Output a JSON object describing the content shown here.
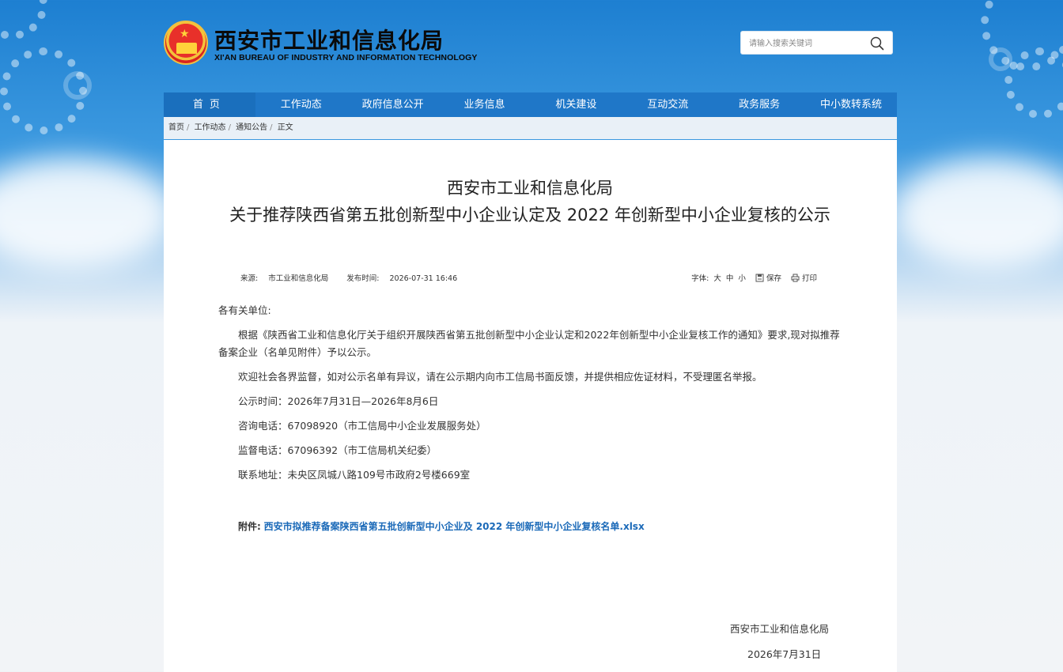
{
  "header": {
    "title": "西安市工业和信息化局",
    "subtitle": "XI'AN BUREAU OF INDUSTRY AND INFORMATION TECHNOLOGY",
    "search_placeholder": "请输入搜索关键词"
  },
  "nav": {
    "items": [
      "首页",
      "工作动态",
      "政府信息公开",
      "业务信息",
      "机关建设",
      "互动交流",
      "政务服务",
      "中小数转系统"
    ]
  },
  "breadcrumb": [
    "首页",
    "工作动态",
    "通知公告",
    "正文"
  ],
  "article": {
    "title_line1": "西安市工业和信息化局",
    "title_line2": "关于推荐陕西省第五批创新型中小企业认定及 2022 年创新型中小企业复核的公示",
    "source_label": "来源:",
    "source": "市工业和信息化局",
    "time_label": "发布时间:",
    "time": "2026-07-31 16:46",
    "font_label": "字体:",
    "font_large": "大",
    "font_medium": "中",
    "font_small": "小",
    "save": "保存",
    "print": "打印",
    "greeting": "各有关单位:",
    "para1": "根据《陕西省工业和信息化厅关于组织开展陕西省第五批创新型中小企业认定和2022年创新型中小企业复核工作的通知》要求,现对拟推荐备案企业（名单见附件）予以公示。",
    "para2": "欢迎社会各界监督，如对公示名单有异议，请在公示期内向市工信局书面反馈，并提供相应佐证材料，不受理匿名举报。",
    "para3": "公示时间：2026年7月31日—2026年8月6日",
    "para4": "咨询电话：67098920（市工信局中小企业发展服务处）",
    "para5": "监督电话：67096392（市工信局机关纪委）",
    "para6": "联系地址：未央区凤城八路109号市政府2号楼669室",
    "attachment_label": "附件:",
    "attachment_link": "西安市拟推荐备案陕西省第五批创新型中小企业及 2022 年创新型中小企业复核名单.xlsx",
    "signature_org": "西安市工业和信息化局",
    "signature_date": "2026年7月31日"
  }
}
